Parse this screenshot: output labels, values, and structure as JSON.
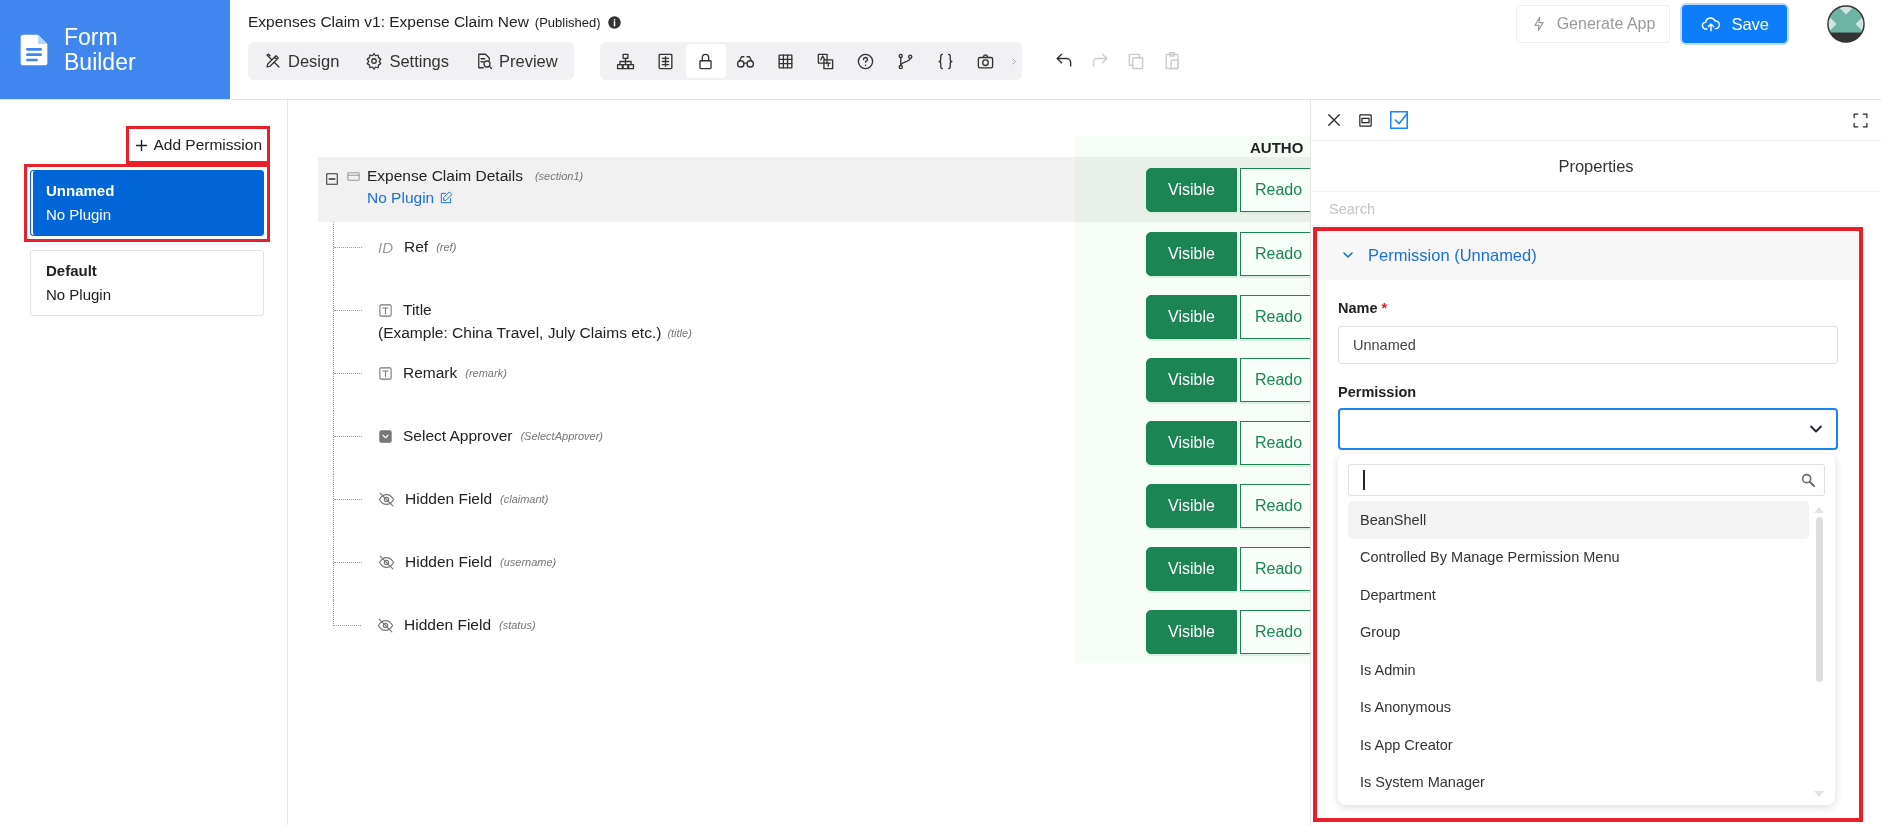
{
  "app": {
    "name": "Form Builder"
  },
  "header": {
    "title": "Expenses Claim v1: Expense Claim New",
    "status": "(Published)",
    "tabs": [
      {
        "kind": "design",
        "label": "Design",
        "selected": false
      },
      {
        "kind": "settings",
        "label": "Settings",
        "selected": false
      },
      {
        "kind": "preview",
        "label": "Preview",
        "selected": false
      }
    ],
    "tools": [
      {
        "kind": "hierarchy",
        "selected": false
      },
      {
        "kind": "section",
        "selected": false
      },
      {
        "kind": "lock",
        "selected": true
      },
      {
        "kind": "binoculars",
        "selected": false
      },
      {
        "kind": "grid",
        "selected": false
      },
      {
        "kind": "translate",
        "selected": false
      },
      {
        "kind": "help",
        "selected": false
      },
      {
        "kind": "branch",
        "selected": false
      },
      {
        "kind": "braces",
        "selected": false
      },
      {
        "kind": "camera",
        "selected": false
      },
      {
        "kind": "more",
        "selected": false
      }
    ],
    "edit_actions": [
      {
        "kind": "undo",
        "disabled": false
      },
      {
        "kind": "redo",
        "disabled": true
      },
      {
        "kind": "copy",
        "disabled": true
      },
      {
        "kind": "paste",
        "disabled": true
      }
    ],
    "generate_button": {
      "label": "Generate App",
      "disabled": true
    },
    "save_button": {
      "label": "Save"
    }
  },
  "permissions": {
    "add_button": {
      "label": "Add Permission",
      "highlighted": true
    },
    "items": [
      {
        "name": "Unnamed",
        "plugin": "No Plugin",
        "selected": true,
        "highlighted": true
      },
      {
        "name": "Default",
        "plugin": "No Plugin",
        "selected": false,
        "highlighted": false
      }
    ]
  },
  "grid": {
    "column_header": "AUTHO",
    "section": {
      "label": "Expense Claim Details",
      "id": "(section1)",
      "plugin_link": "No Plugin",
      "expanded": true,
      "access": [
        {
          "label": "Visible",
          "selected": true
        },
        {
          "label": "Reado",
          "selected": false
        }
      ]
    },
    "fields": [
      {
        "kind": "id",
        "tag": "ID",
        "label": "Ref",
        "id": "(ref)",
        "access": [
          {
            "label": "Visible",
            "selected": true
          },
          {
            "label": "Reado",
            "selected": false
          }
        ]
      },
      {
        "kind": "text",
        "label": "Title",
        "note": "(Example: China Travel, July Claims etc.)",
        "id": "(title)",
        "access": [
          {
            "label": "Visible",
            "selected": true
          },
          {
            "label": "Reado",
            "selected": false
          }
        ]
      },
      {
        "kind": "text",
        "label": "Remark",
        "id": "(remark)",
        "access": [
          {
            "label": "Visible",
            "selected": true
          },
          {
            "label": "Reado",
            "selected": false
          }
        ]
      },
      {
        "kind": "select",
        "label": "Select Approver",
        "id": "(SelectApprover)",
        "access": [
          {
            "label": "Visible",
            "selected": true
          },
          {
            "label": "Reado",
            "selected": false
          }
        ]
      },
      {
        "kind": "hidden",
        "label": "Hidden Field",
        "id": "(claimant)",
        "access": [
          {
            "label": "Visible",
            "selected": true
          },
          {
            "label": "Reado",
            "selected": false
          }
        ]
      },
      {
        "kind": "hidden",
        "label": "Hidden Field",
        "id": "(username)",
        "access": [
          {
            "label": "Visible",
            "selected": true
          },
          {
            "label": "Reado",
            "selected": false
          }
        ]
      },
      {
        "kind": "hidden",
        "label": "Hidden Field",
        "id": "(status)",
        "access": [
          {
            "label": "Visible",
            "selected": true
          },
          {
            "label": "Reado",
            "selected": false
          }
        ]
      }
    ]
  },
  "properties": {
    "tools": [
      {
        "kind": "close",
        "selected": false
      },
      {
        "kind": "form",
        "selected": false
      },
      {
        "kind": "checkbox",
        "selected": true
      }
    ],
    "title": "Properties",
    "search": {
      "placeholder": "Search"
    },
    "section": {
      "title": "Permission (Unnamed)",
      "expanded": true,
      "highlighted": true,
      "name_field": {
        "label": "Name",
        "required_mark": "*",
        "value": "Unnamed"
      },
      "permission_field": {
        "label": "Permission",
        "open": true,
        "options": [
          {
            "label": "BeanShell",
            "selected": true
          },
          {
            "label": "Controlled By Manage Permission Menu",
            "selected": false
          },
          {
            "label": "Department",
            "selected": false
          },
          {
            "label": "Group",
            "selected": false
          },
          {
            "label": "Is Admin",
            "selected": false
          },
          {
            "label": "Is Anonymous",
            "selected": false
          },
          {
            "label": "Is App Creator",
            "selected": false
          },
          {
            "label": "Is System Manager",
            "selected": false
          }
        ]
      }
    }
  }
}
